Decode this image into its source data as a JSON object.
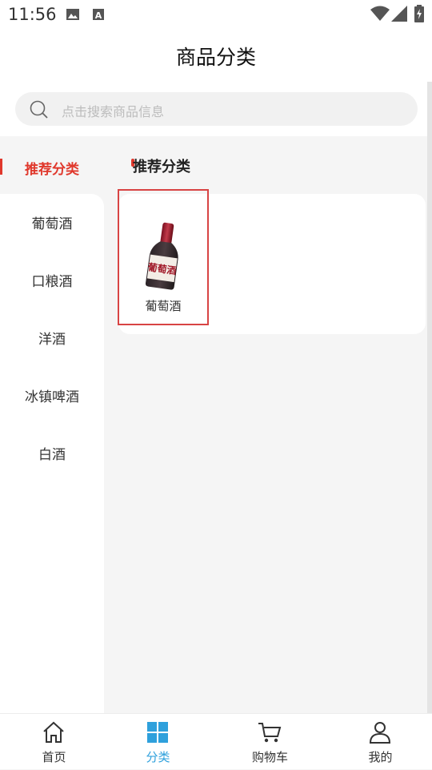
{
  "status_bar": {
    "time": "11:56",
    "icons": [
      "image-icon",
      "text-a-icon",
      "wifi-icon",
      "signal-icon",
      "battery-icon"
    ]
  },
  "header": {
    "title": "商品分类"
  },
  "search": {
    "placeholder": "点击搜索商品信息",
    "icon": "search-icon"
  },
  "sidebar": {
    "active": "推荐分类",
    "items": [
      {
        "label": "葡萄酒"
      },
      {
        "label": "口粮酒"
      },
      {
        "label": "洋酒"
      },
      {
        "label": "冰镇啤酒"
      },
      {
        "label": "白酒"
      }
    ]
  },
  "content": {
    "section_title": "推荐分类",
    "products": [
      {
        "label": "葡萄酒",
        "image_text": "葡萄酒",
        "icon": "wine-bottle-icon"
      }
    ]
  },
  "tabbar": {
    "items": [
      {
        "label": "首页",
        "icon": "home-icon"
      },
      {
        "label": "分类",
        "icon": "category-grid-icon"
      },
      {
        "label": "购物车",
        "icon": "cart-icon"
      },
      {
        "label": "我的",
        "icon": "user-icon"
      }
    ],
    "active_index": 1,
    "active_color": "#2ea0dc"
  },
  "colors": {
    "accent": "#e0382c",
    "tab_active": "#2ea0dc",
    "background": "#f5f5f5"
  }
}
